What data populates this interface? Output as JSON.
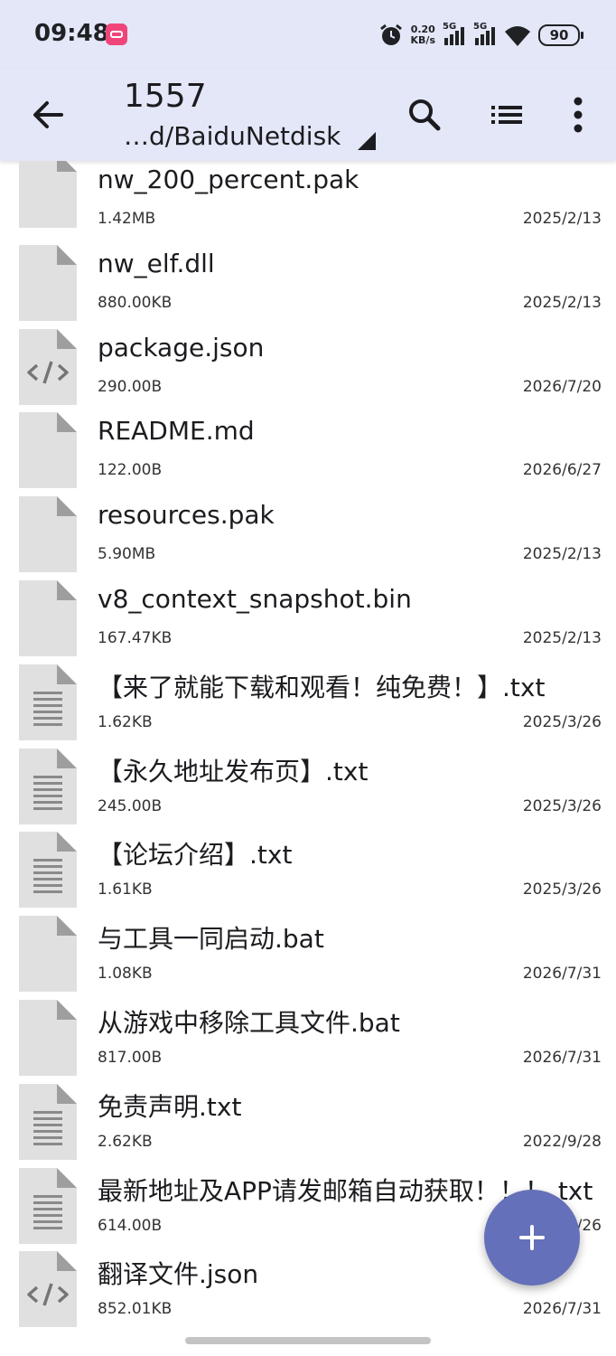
{
  "status_bar": {
    "time": "09:48",
    "net_speed_value": "0.20",
    "net_speed_unit": "KB/s",
    "signal1_label": "5G",
    "signal2_label": "5G",
    "battery": "90"
  },
  "toolbar": {
    "title": "1557",
    "path": "…d/BaiduNetdisk"
  },
  "files": [
    {
      "name": "nw_200_percent.pak",
      "size": "1.42MB",
      "date": "2025/2/13",
      "type": "generic"
    },
    {
      "name": "nw_elf.dll",
      "size": "880.00KB",
      "date": "2025/2/13",
      "type": "generic"
    },
    {
      "name": "package.json",
      "size": "290.00B",
      "date": "2026/7/20",
      "type": "code"
    },
    {
      "name": "README.md",
      "size": "122.00B",
      "date": "2026/6/27",
      "type": "generic"
    },
    {
      "name": "resources.pak",
      "size": "5.90MB",
      "date": "2025/2/13",
      "type": "generic"
    },
    {
      "name": "v8_context_snapshot.bin",
      "size": "167.47KB",
      "date": "2025/2/13",
      "type": "generic"
    },
    {
      "name": "【来了就能下载和观看！纯免费！】.txt",
      "size": "1.62KB",
      "date": "2025/3/26",
      "type": "text"
    },
    {
      "name": "【永久地址发布页】.txt",
      "size": "245.00B",
      "date": "2025/3/26",
      "type": "text"
    },
    {
      "name": "【论坛介绍】.txt",
      "size": "1.61KB",
      "date": "2025/3/26",
      "type": "text"
    },
    {
      "name": "与工具一同启动.bat",
      "size": "1.08KB",
      "date": "2026/7/31",
      "type": "generic"
    },
    {
      "name": "从游戏中移除工具文件.bat",
      "size": "817.00B",
      "date": "2026/7/31",
      "type": "generic"
    },
    {
      "name": "免责声明.txt",
      "size": "2.62KB",
      "date": "2022/9/28",
      "type": "text"
    },
    {
      "name": "最新地址及APP请发邮箱自动获取！！！.txt",
      "size": "614.00B",
      "date": "/26",
      "type": "text"
    },
    {
      "name": "翻译文件.json",
      "size": "852.01KB",
      "date": "2026/7/31",
      "type": "code"
    }
  ],
  "colors": {
    "appbar": "#e3e7f7",
    "fab": "#6470b9",
    "icon_fill": "#e0e0e0",
    "icon_fold": "#9e9e9e"
  }
}
